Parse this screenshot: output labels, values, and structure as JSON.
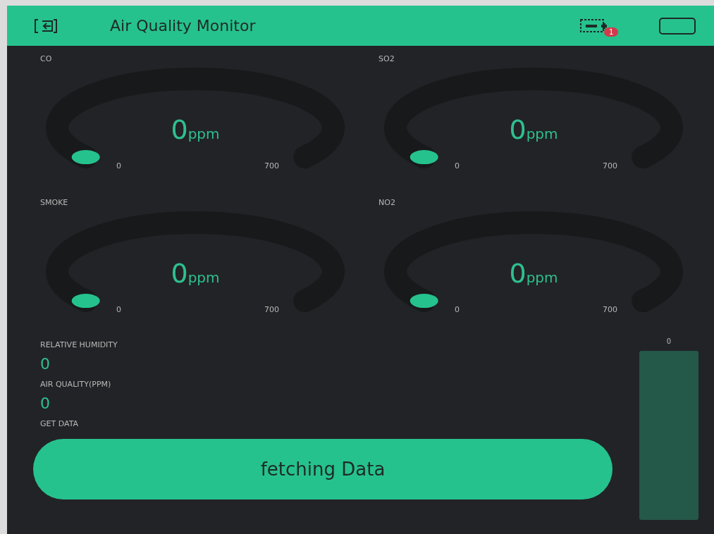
{
  "header": {
    "title": "Air Quality Monitor",
    "badge": "1"
  },
  "gauges": [
    {
      "label": "CO",
      "value": "0",
      "unit": "ppm",
      "min": "0",
      "max": "700"
    },
    {
      "label": "SO2",
      "value": "0",
      "unit": "ppm",
      "min": "0",
      "max": "700"
    },
    {
      "label": "SMOKE",
      "value": "0",
      "unit": "ppm",
      "min": "0",
      "max": "700"
    },
    {
      "label": "NO2",
      "value": "0",
      "unit": "ppm",
      "min": "0",
      "max": "700"
    }
  ],
  "displays": [
    {
      "label": "RELATIVE HUMIDITY",
      "value": "0"
    },
    {
      "label": "AIR QUALITY(PPM)",
      "value": "0"
    }
  ],
  "button": {
    "label": "GET DATA",
    "text": "fetching Data"
  },
  "level_bar": {
    "reading": "0"
  }
}
